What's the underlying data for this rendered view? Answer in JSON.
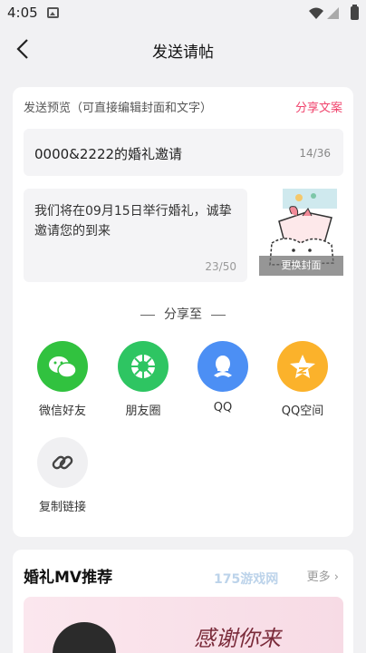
{
  "status_bar": {
    "time": "4:05"
  },
  "header": {
    "title": "发送请帖"
  },
  "preview": {
    "label": "发送预览（可直接编辑封面和文字）",
    "share_copy": "分享文案",
    "title_value": "0000&2222的婚礼邀请",
    "title_count": "14/36",
    "desc_value": "我们将在09月15日举行婚礼，诚挚邀请您的到来",
    "desc_count": "23/50",
    "cover_button": "更换封面"
  },
  "share": {
    "heading": "分享至",
    "targets": [
      {
        "label": "微信好友",
        "icon": "wechat-icon",
        "color": "#31c23f"
      },
      {
        "label": "朋友圈",
        "icon": "moments-icon",
        "color": "#2ec562"
      },
      {
        "label": "QQ",
        "icon": "qq-icon",
        "color": "#4c8ff4"
      },
      {
        "label": "QQ空间",
        "icon": "qzone-icon",
        "color": "#fbb22b"
      },
      {
        "label": "复制链接",
        "icon": "link-icon",
        "color": "#f0f0f2"
      }
    ]
  },
  "mv": {
    "title": "婚礼MV推荐",
    "more": "更多",
    "watermark": "175游戏网",
    "banner_text": "感谢你来"
  }
}
